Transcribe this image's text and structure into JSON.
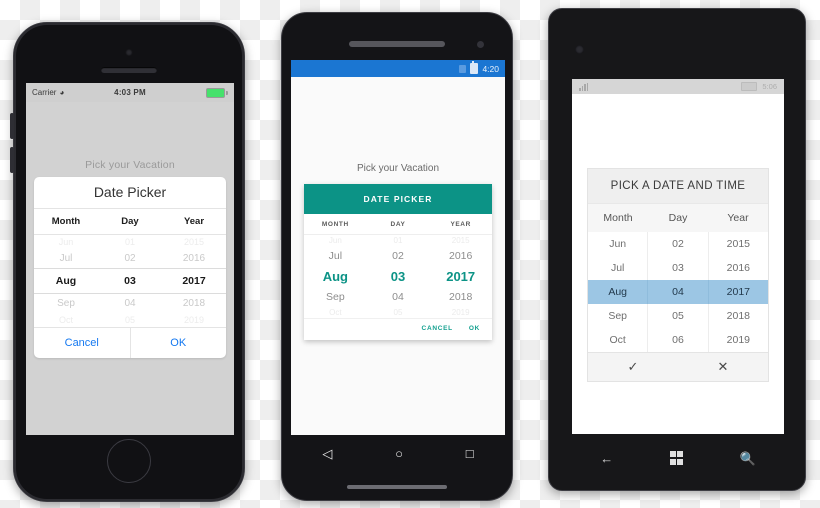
{
  "iphone": {
    "status": {
      "carrier": "Carrier",
      "wifi_icon": "wifi-icon",
      "time": "4:03 PM",
      "battery_icon": "battery-icon"
    },
    "screen_title": "Pick your Vacation",
    "card_title": "Date Picker",
    "columns": [
      "Month",
      "Day",
      "Year"
    ],
    "rows": [
      {
        "month": "Jun",
        "day": "01",
        "year": "2015",
        "state": "faint"
      },
      {
        "month": "Jul",
        "day": "02",
        "year": "2016",
        "state": "dim"
      },
      {
        "month": "Aug",
        "day": "03",
        "year": "2017",
        "state": "selected"
      },
      {
        "month": "Sep",
        "day": "04",
        "year": "2018",
        "state": "dim"
      },
      {
        "month": "Oct",
        "day": "05",
        "year": "2019",
        "state": "faint"
      }
    ],
    "actions": {
      "cancel": "Cancel",
      "ok": "OK"
    },
    "home_button": "home-button"
  },
  "android": {
    "status": {
      "time": "4:20",
      "icons": [
        "sim-icon",
        "battery-icon"
      ]
    },
    "screen_title": "Pick your Vacation",
    "card_title": "DATE PICKER",
    "columns": [
      "MONTH",
      "DAY",
      "YEAR"
    ],
    "rows": [
      {
        "month": "Jun",
        "day": "01",
        "year": "2015",
        "state": "faint"
      },
      {
        "month": "Jul",
        "day": "02",
        "year": "2016",
        "state": "dim"
      },
      {
        "month": "Aug",
        "day": "03",
        "year": "2017",
        "state": "selected"
      },
      {
        "month": "Sep",
        "day": "04",
        "year": "2018",
        "state": "dim"
      },
      {
        "month": "Oct",
        "day": "05",
        "year": "2019",
        "state": "faint"
      }
    ],
    "actions": {
      "cancel": "CANCEL",
      "ok": "OK"
    },
    "nav": {
      "back": "◁",
      "home": "○",
      "recents": "□"
    }
  },
  "windows": {
    "status": {
      "signal_icon": "signal-icon",
      "battery_icon": "battery-icon",
      "time": "5:06"
    },
    "card_title": "PICK A DATE AND TIME",
    "columns": [
      "Month",
      "Day",
      "Year"
    ],
    "rows": [
      {
        "month": "Jun",
        "day": "02",
        "year": "2015",
        "state": "dim"
      },
      {
        "month": "Jul",
        "day": "03",
        "year": "2016",
        "state": "dim"
      },
      {
        "month": "Aug",
        "day": "04",
        "year": "2017",
        "state": "selected"
      },
      {
        "month": "Sep",
        "day": "05",
        "year": "2018",
        "state": "dim"
      },
      {
        "month": "Oct",
        "day": "06",
        "year": "2019",
        "state": "dim"
      }
    ],
    "actions": {
      "accept": "✓",
      "cancel": "✕"
    },
    "nav": {
      "back": "←",
      "start": "windows-logo-icon",
      "search": "⚲"
    }
  },
  "colors": {
    "ios_accent": "#1478f0",
    "android_teal": "#0c9386",
    "android_status": "#1b76d2",
    "windows_highlight": "#9cc6e4"
  }
}
